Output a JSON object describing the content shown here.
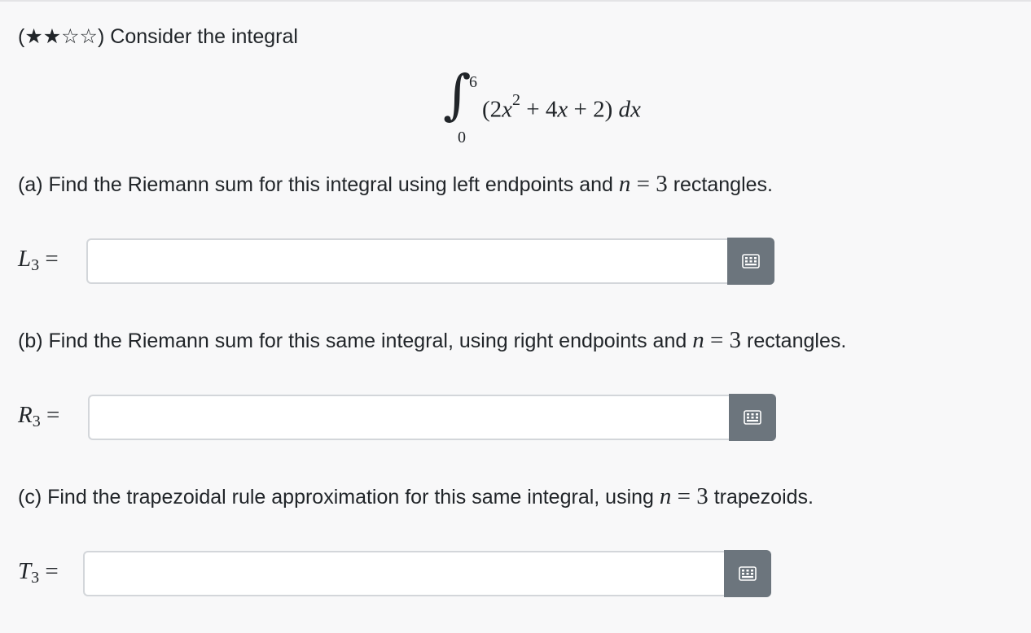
{
  "intro": {
    "stars": "(★★☆☆)",
    "text": "Consider the integral"
  },
  "integral": {
    "upper": "6",
    "lower": "0",
    "integrand": {
      "open": "(2",
      "var1": "x",
      "exp": "2",
      "mid": " + 4",
      "var2": "x",
      "end": " + 2) ",
      "dx": "dx"
    }
  },
  "parts": [
    {
      "question_pre": "(a) Find the Riemann sum for this integral using left endpoints and ",
      "n_var": "n",
      "n_eq": " = 3",
      "question_post": " rectangles.",
      "label_var": "L",
      "label_sub": "3",
      "label_eq": " =",
      "input_value": "",
      "keyboard_icon": "keyboard-icon"
    },
    {
      "question_pre": "(b) Find the Riemann sum for this same integral, using right endpoints and ",
      "n_var": "n",
      "n_eq": " = 3",
      "question_post": " rectangles.",
      "label_var": "R",
      "label_sub": "3",
      "label_eq": " =",
      "input_value": "",
      "keyboard_icon": "keyboard-icon"
    },
    {
      "question_pre": "(c) Find the trapezoidal rule approximation for this same integral, using ",
      "n_var": "n",
      "n_eq": " = 3",
      "question_post": " trapezoids.",
      "label_var": "T",
      "label_sub": "3",
      "label_eq": " =",
      "input_value": "",
      "keyboard_icon": "keyboard-icon"
    }
  ],
  "colors": {
    "button": "#6c757d",
    "border": "#d3d6da",
    "background": "#f8f8f9"
  }
}
